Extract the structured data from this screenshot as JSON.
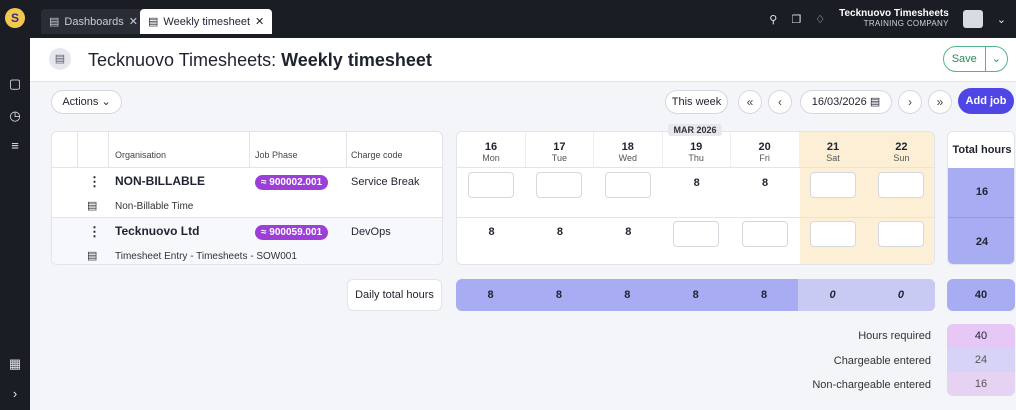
{
  "tabs": [
    {
      "label": "Dashboards"
    },
    {
      "label": "Weekly timesheet"
    }
  ],
  "org": {
    "name": "Tecknuovo Timesheets",
    "company": "TRAINING COMPANY"
  },
  "header": {
    "prefix": "Tecknuovo Timesheets: ",
    "title": "Weekly timesheet",
    "save_label": "Save"
  },
  "toolbar": {
    "actions_label": "Actions",
    "this_week_label": "This week",
    "date_value": "16/03/2026",
    "add_job_label": "Add job"
  },
  "table": {
    "columns": {
      "organisation": "Organisation",
      "job_phase": "Job Phase",
      "charge_code": "Charge code"
    },
    "rows": [
      {
        "organisation": "NON-BILLABLE",
        "description": "Non-Billable Time",
        "job_phase": "900002.001",
        "charge_code": "Service Break",
        "hours": [
          "",
          "",
          "",
          "8",
          "8",
          "",
          ""
        ],
        "total": "16"
      },
      {
        "organisation": "Tecknuovo Ltd",
        "description": "Timesheet Entry - Timesheets - SOW001",
        "job_phase": "900059.001",
        "charge_code": "DevOps",
        "hours": [
          "8",
          "8",
          "8",
          "",
          "",
          "",
          ""
        ],
        "total": "24"
      }
    ]
  },
  "month_label": "MAR 2026",
  "days": [
    {
      "date": "16",
      "day": "Mon"
    },
    {
      "date": "17",
      "day": "Tue"
    },
    {
      "date": "18",
      "day": "Wed"
    },
    {
      "date": "19",
      "day": "Thu"
    },
    {
      "date": "20",
      "day": "Fri"
    },
    {
      "date": "21",
      "day": "Sat"
    },
    {
      "date": "22",
      "day": "Sun"
    }
  ],
  "total_hours_label": "Total hours",
  "daily_total": {
    "label": "Daily total hours",
    "values": [
      "8",
      "8",
      "8",
      "8",
      "8",
      "0",
      "0"
    ],
    "total": "40"
  },
  "summary": [
    {
      "label": "Hours required",
      "value": "40"
    },
    {
      "label": "Chargeable entered",
      "value": "24"
    },
    {
      "label": "Non-chargeable entered",
      "value": "16"
    }
  ],
  "colors": {
    "accent": "#4f46e5",
    "phase_badge": "#9b3fd6",
    "total_fill": "#a8acf2",
    "weekend": "#fcefd6",
    "save": "#52b788"
  }
}
